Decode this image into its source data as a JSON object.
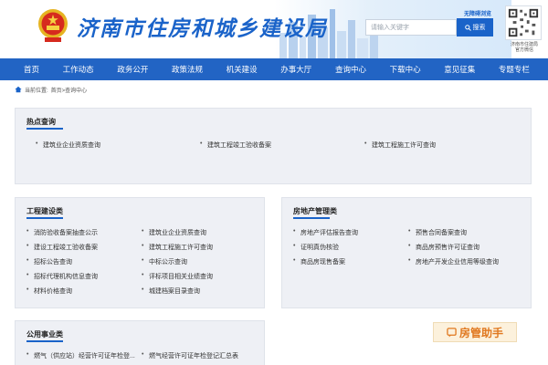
{
  "header": {
    "site_title": "济南市住房和城乡建设局",
    "access_link": "无障碍浏览",
    "search_placeholder": "请输入关键字",
    "search_button": "搜索",
    "qr_caption_line1": "济南市住建局",
    "qr_caption_line2": "官方微信"
  },
  "nav": {
    "items": [
      "首页",
      "工作动态",
      "政务公开",
      "政策法规",
      "机关建设",
      "办事大厅",
      "查询中心",
      "下载中心",
      "意见征集",
      "专题专栏"
    ]
  },
  "breadcrumb": {
    "label": "当前位置:",
    "path": "首页>查询中心"
  },
  "hot_query": {
    "title": "热点查询",
    "links": [
      "建筑业企业资质查询",
      "建筑工程竣工验收备案",
      "建筑工程施工许可查询"
    ]
  },
  "engineering": {
    "title": "工程建设类",
    "links": [
      "消防验收备案抽查公示",
      "建筑业企业资质查询",
      "建设工程竣工验收备案",
      "建筑工程施工许可查询",
      "招标公告查询",
      "中标公示查询",
      "招标代理机构信息查询",
      "评标项目相关业绩查询",
      "材料价格查询",
      "城建档案目录查询"
    ]
  },
  "real_estate": {
    "title": "房地产管理类",
    "links": [
      "房地产评估报告查询",
      "预售合同备案查询",
      "证明真伪核验",
      "商品房预售许可证查询",
      "商品房现售备案",
      "房地产开发企业信用等级查询"
    ]
  },
  "utilities": {
    "title": "公用事业类",
    "links": [
      "燃气（供应站）经营许可证年检登...",
      "燃气经营许可证年检登记汇总表"
    ]
  },
  "helper": {
    "label": "房管助手"
  },
  "colors": {
    "brand_blue": "#1a63c9",
    "nav_blue": "#2264c4",
    "panel_bg": "#eef0f5",
    "helper_orange": "#e0781f"
  }
}
